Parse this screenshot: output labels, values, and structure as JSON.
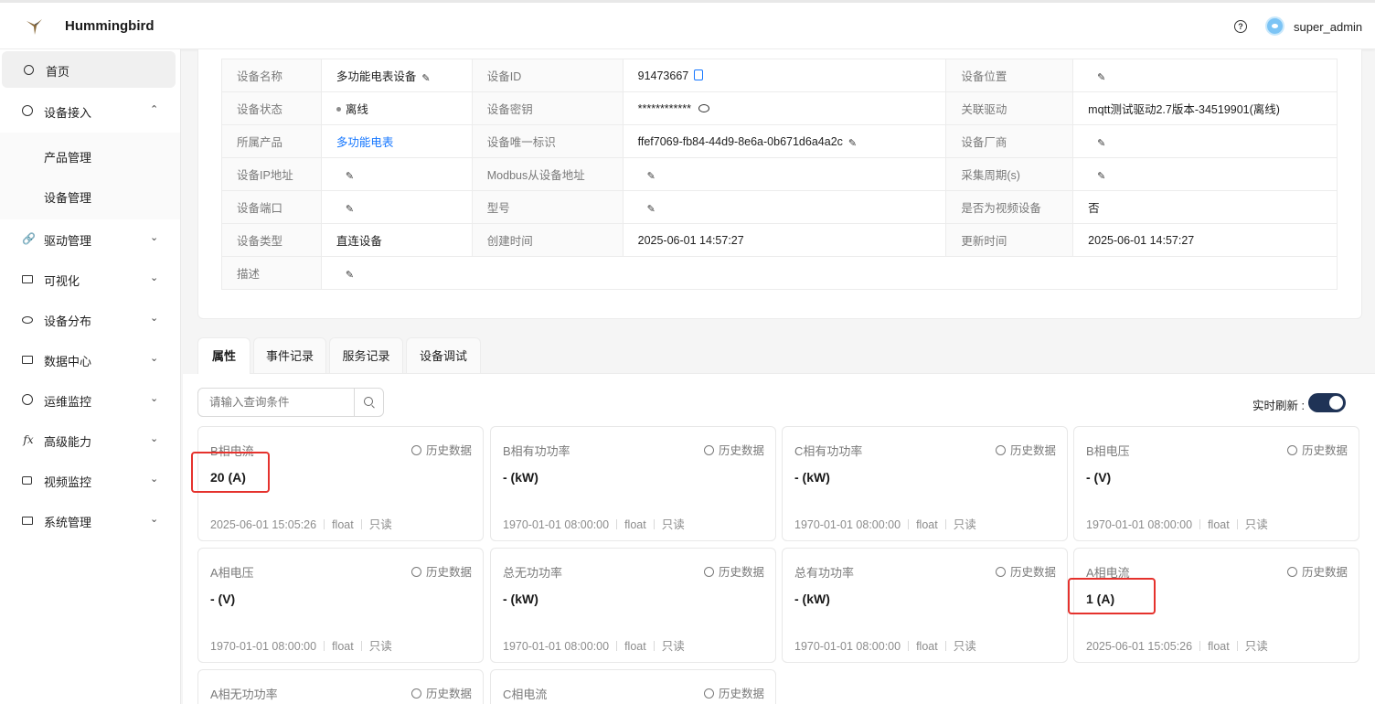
{
  "header": {
    "app_title": "Hummingbird",
    "username": "super_admin",
    "help_icon": "question-circle-icon"
  },
  "sidebar": {
    "items": [
      {
        "label": "首页",
        "icon": "home-icon"
      },
      {
        "label": "设备接入",
        "icon": "globe-icon",
        "expanded": true
      },
      {
        "label": "驱动管理",
        "icon": "link-icon"
      },
      {
        "label": "可视化",
        "icon": "monitor-icon"
      },
      {
        "label": "设备分布",
        "icon": "eye-icon"
      },
      {
        "label": "数据中心",
        "icon": "chart-screen-icon"
      },
      {
        "label": "运维监控",
        "icon": "clock-icon"
      },
      {
        "label": "高级能力",
        "icon": "fx-icon"
      },
      {
        "label": "视频监控",
        "icon": "video-icon"
      },
      {
        "label": "系统管理",
        "icon": "desktop-icon"
      }
    ],
    "sub_items": [
      "产品管理",
      "设备管理"
    ]
  },
  "device_info": {
    "rows": [
      [
        {
          "k": "设备名称",
          "v": "多功能电表设备"
        },
        {
          "k": "设备ID",
          "v": "91473667"
        },
        {
          "k": "设备位置",
          "v": ""
        }
      ],
      [
        {
          "k": "设备状态",
          "v": "离线"
        },
        {
          "k": "设备密钥",
          "v": "************"
        },
        {
          "k": "关联驱动",
          "v": "mqtt测试驱动2.7版本-34519901(离线)"
        }
      ],
      [
        {
          "k": "所属产品",
          "v": "多功能电表"
        },
        {
          "k": "设备唯一标识",
          "v": "ffef7069-fb84-44d9-8e6a-0b671d6a4a2c"
        },
        {
          "k": "设备厂商",
          "v": ""
        }
      ],
      [
        {
          "k": "设备IP地址",
          "v": ""
        },
        {
          "k": "Modbus从设备地址",
          "v": ""
        },
        {
          "k": "采集周期(s)",
          "v": ""
        }
      ],
      [
        {
          "k": "设备端口",
          "v": ""
        },
        {
          "k": "型号",
          "v": ""
        },
        {
          "k": "是否为视频设备",
          "v": "否"
        }
      ],
      [
        {
          "k": "设备类型",
          "v": "直连设备"
        },
        {
          "k": "创建时间",
          "v": "2025-06-01 14:57:27"
        },
        {
          "k": "更新时间",
          "v": "2025-06-01 14:57:27"
        }
      ],
      [
        {
          "k": "描述",
          "v": ""
        }
      ]
    ]
  },
  "tabs": [
    "属性",
    "事件记录",
    "服务记录",
    "设备调试"
  ],
  "search": {
    "placeholder": "请输入查询条件"
  },
  "realtime": {
    "label": "实时刷新 :",
    "enabled": true
  },
  "history_label": "历史数据",
  "properties": [
    {
      "name": "B相电流",
      "value": "20 (A)",
      "time": "2025-06-01 15:05:26",
      "type": "float",
      "access": "只读"
    },
    {
      "name": "B相有功功率",
      "value": "- (kW)",
      "time": "1970-01-01 08:00:00",
      "type": "float",
      "access": "只读"
    },
    {
      "name": "C相有功功率",
      "value": "- (kW)",
      "time": "1970-01-01 08:00:00",
      "type": "float",
      "access": "只读"
    },
    {
      "name": "B相电压",
      "value": "- (V)",
      "time": "1970-01-01 08:00:00",
      "type": "float",
      "access": "只读"
    },
    {
      "name": "A相电压",
      "value": "- (V)",
      "time": "1970-01-01 08:00:00",
      "type": "float",
      "access": "只读"
    },
    {
      "name": "总无功功率",
      "value": "- (kW)",
      "time": "1970-01-01 08:00:00",
      "type": "float",
      "access": "只读"
    },
    {
      "name": "总有功功率",
      "value": "- (kW)",
      "time": "1970-01-01 08:00:00",
      "type": "float",
      "access": "只读"
    },
    {
      "name": "A相电流",
      "value": "1 (A)",
      "time": "2025-06-01 15:05:26",
      "type": "float",
      "access": "只读"
    },
    {
      "name": "A相无功功率",
      "value": "",
      "time": "",
      "type": "",
      "access": ""
    },
    {
      "name": "C相电流",
      "value": "",
      "time": "",
      "type": "",
      "access": ""
    }
  ],
  "colors": {
    "highlight": "#e5322d",
    "link": "#1677ff",
    "toggle": "#1f3356"
  }
}
